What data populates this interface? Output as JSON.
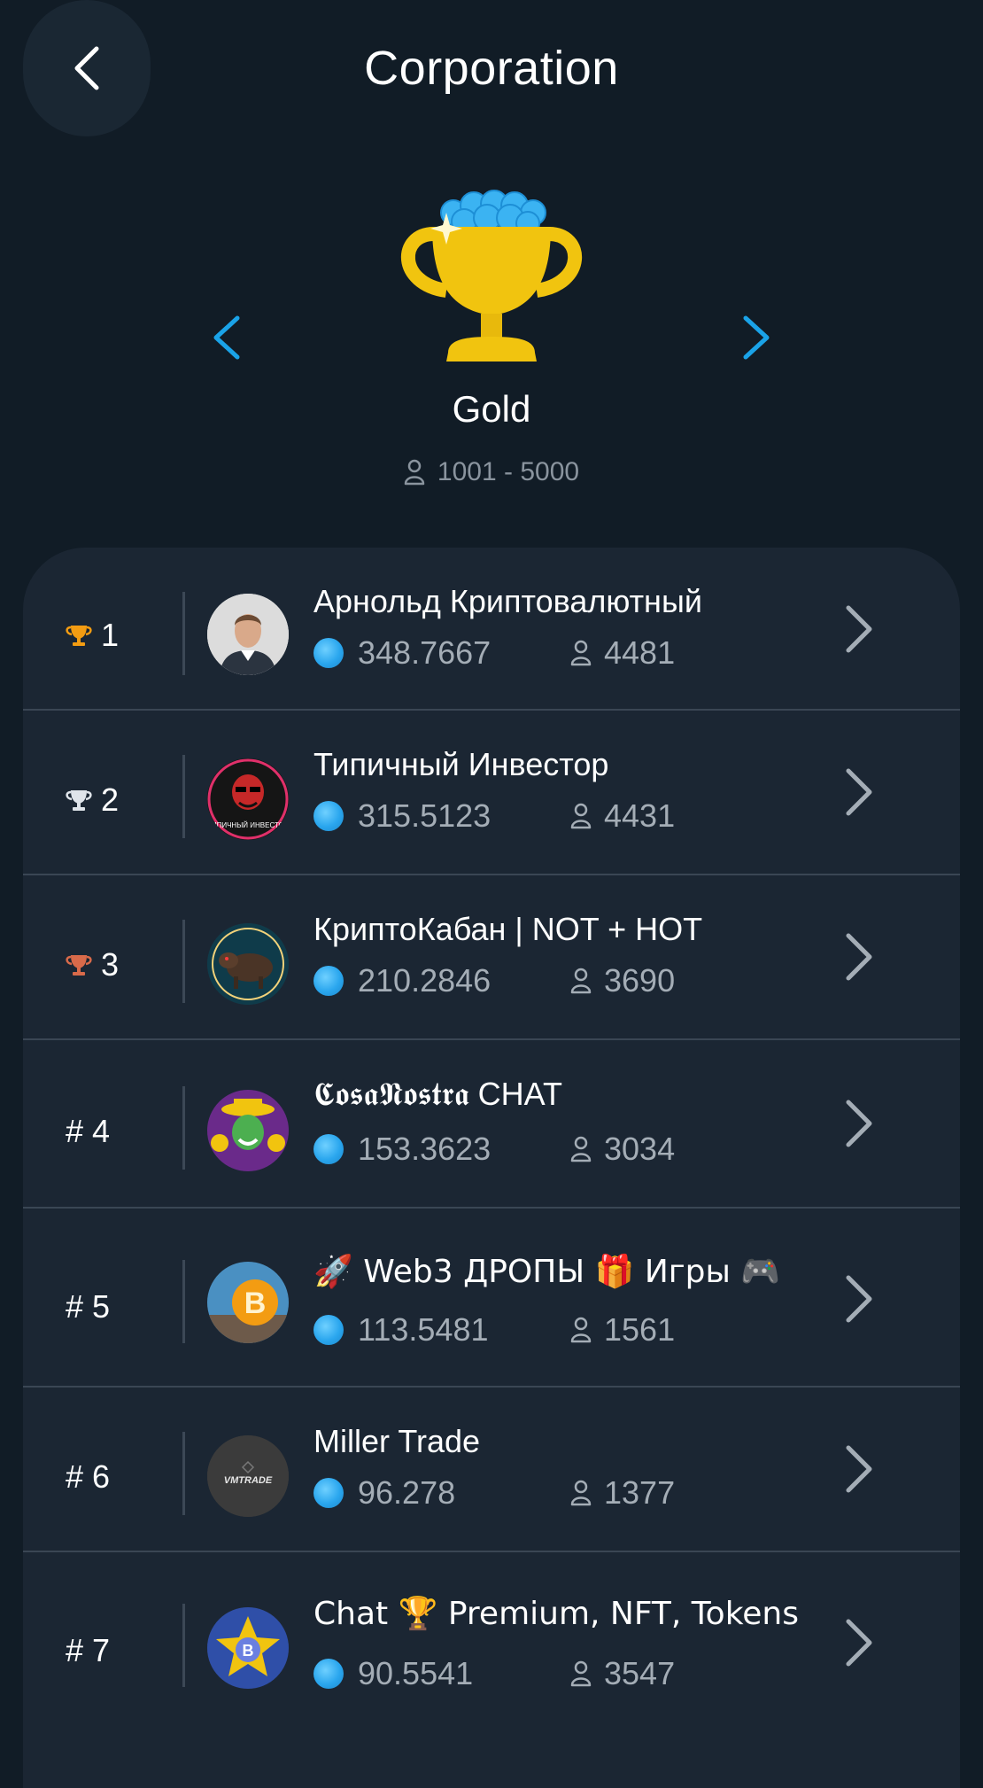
{
  "header": {
    "title": "Corporation"
  },
  "league": {
    "name": "Gold",
    "range": "1001 - 5000"
  },
  "rows": [
    {
      "rank": "1",
      "rank_style": "gold",
      "name": "Арнольд Криптовалютный",
      "coins": "348.7667",
      "members": "4481",
      "avatar": "man-photo"
    },
    {
      "rank": "2",
      "rank_style": "silver",
      "name": "Типичный Инвестор",
      "coins": "315.5123",
      "members": "4431",
      "avatar": "investor-logo"
    },
    {
      "rank": "3",
      "rank_style": "bronze",
      "name": "КриптоКабан | NOT + HOT",
      "coins": "210.2846",
      "members": "3690",
      "avatar": "boar"
    },
    {
      "rank": "# 4",
      "rank_style": "plain",
      "name": "𝕮𝖔𝖘𝖆𝕹𝖔𝖘𝖙𝖗𝖆 CHAT",
      "coins": "153.3623",
      "members": "3034",
      "avatar": "mask"
    },
    {
      "rank": "# 5",
      "rank_style": "plain",
      "name": "🚀 Web3 ДРОПЫ 🎁 Игры 🎮",
      "coins": "113.5481",
      "members": "1561",
      "avatar": "bitcoin"
    },
    {
      "rank": "# 6",
      "rank_style": "plain",
      "name": "Miller Trade",
      "coins": "96.278",
      "members": "1377",
      "avatar": "vmtrade"
    },
    {
      "rank": "# 7",
      "rank_style": "plain",
      "name": "Chat 🏆 Premium, NFT, Tokens",
      "coins": "90.5541",
      "members": "3547",
      "avatar": "star-bitcoin"
    }
  ],
  "avatars": {
    "vmtrade_text": "VMTRADE",
    "investor_text": "ТИПИЧНЫЙ ИНВЕСТОР"
  },
  "colors": {
    "accent": "#1aa3e8",
    "gold": "#f1c40f",
    "background": "#111c26",
    "card": "#1b2633"
  }
}
